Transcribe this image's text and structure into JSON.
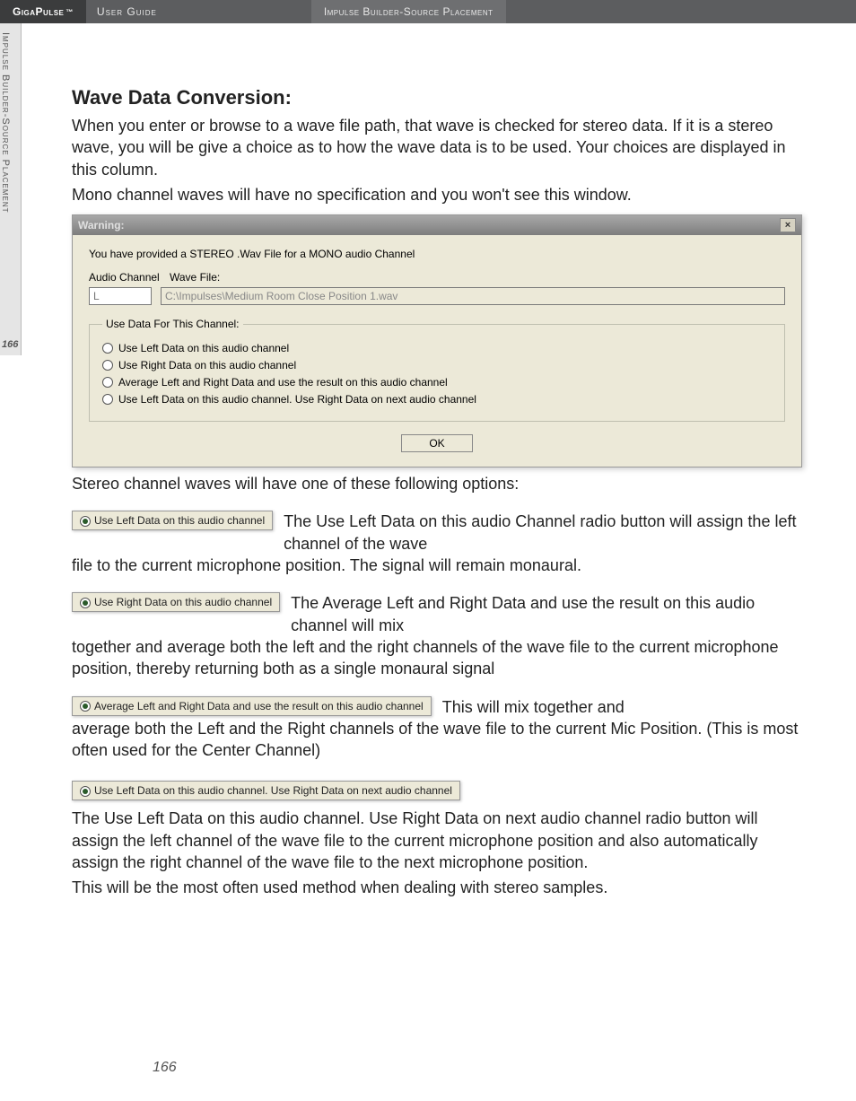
{
  "topbar": {
    "brand": "GigaPulse",
    "tm": "™",
    "subtitle": "User Guide",
    "section": "Impulse Builder-Source Placement"
  },
  "side": {
    "label": "Impulse Builder-Source Placement",
    "page": "166"
  },
  "heading": "Wave Data Conversion:",
  "intro1": "When you enter or browse to a wave file path, that wave is checked for stereo data. If it is a stereo wave, you will be give a choice as to how the wave data is to be used.  Your choices are displayed in this column.",
  "intro2": "Mono channel waves will have no specification and you won't see this window.",
  "dialog": {
    "title": "Warning:",
    "close": "×",
    "message": "You have provided a STEREO .Wav File for a MONO audio Channel",
    "audio_channel_label": "Audio Channel",
    "wave_file_label": "Wave File:",
    "audio_channel_value": "L",
    "wave_file_value": "C:\\Impulses\\Medium Room Close Position 1.wav",
    "group_label": "Use Data For This Channel:",
    "opt1": "Use Left Data on this audio channel",
    "opt2": "Use Right Data on this audio channel",
    "opt3": "Average Left and Right Data and use the result on this audio channel",
    "opt4": "Use Left Data on this audio channel. Use Right Data on next audio channel",
    "ok": "OK"
  },
  "after_dialog": "Stereo channel waves will have one of these following options:",
  "w1": {
    "label": "Use Left Data on this audio channel",
    "text_a": "The Use Left Data on this audio Channel radio button will assign the left channel of the wave",
    "text_b": "file to the current microphone position.  The signal will remain monaural."
  },
  "w2": {
    "label": "Use Right Data on this audio channel",
    "text_a": "The Average Left and Right Data and use the result on this audio channel will mix",
    "text_b": "together and average both the left and the right channels of the wave file to the current microphone position, thereby returning both as a single monaural signal"
  },
  "w3": {
    "label": "Average Left and Right Data and use the result on this audio channel",
    "text_a": "This will mix together and",
    "text_b": "average both the Left and the Right channels of the wave file to the current Mic Position.  (This is most often used for the Center Channel)"
  },
  "w4": {
    "label": "Use Left Data on this audio channel. Use Right Data on next audio channel",
    "text_a": "The Use Left Data on this audio channel. Use Right Data on next audio channel radio button will assign the left channel of the wave file to the current microphone position and also automatically assign the right channel of the wave file to the next microphone position.",
    "text_b": "This will be the most often used method when dealing with stereo samples."
  },
  "footer_page": "166"
}
